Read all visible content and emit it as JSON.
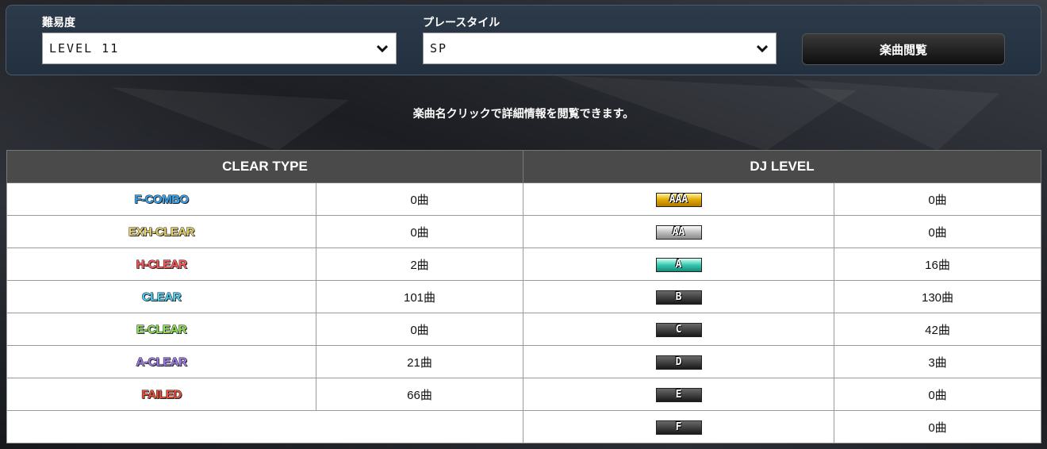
{
  "filter": {
    "difficulty_label": "難易度",
    "difficulty_value": "LEVEL 11",
    "playstyle_label": "プレースタイル",
    "playstyle_value": "SP",
    "browse_button": "楽曲閲覧"
  },
  "note": "楽曲名クリックで詳細情報を閲覧できます。",
  "table": {
    "clear_header": "CLEAR TYPE",
    "dj_header": "DJ LEVEL",
    "clear_rows": [
      {
        "type": "F-COMBO",
        "count": "0曲",
        "color": "#3aa6f0"
      },
      {
        "type": "EXH-CLEAR",
        "count": "0曲",
        "color": "#e8d36a"
      },
      {
        "type": "H-CLEAR",
        "count": "2曲",
        "color": "#ff5a5a"
      },
      {
        "type": "CLEAR",
        "count": "101曲",
        "color": "#4fd0f5"
      },
      {
        "type": "E-CLEAR",
        "count": "0曲",
        "color": "#8fe35a"
      },
      {
        "type": "A-CLEAR",
        "count": "21曲",
        "color": "#9d7be8"
      },
      {
        "type": "FAILED",
        "count": "66曲",
        "color": "#f0503a"
      }
    ],
    "dj_rows": [
      {
        "level": "AAA",
        "count": "0曲",
        "bg": "linear-gradient(#fff4a0,#e0a800,#b07a00)"
      },
      {
        "level": "AA",
        "count": "0曲",
        "bg": "linear-gradient(#ffffff,#bdbdbd,#8a8a8a)"
      },
      {
        "level": "A",
        "count": "16曲",
        "bg": "linear-gradient(#d9fff4,#35c9b0,#168a7a)"
      },
      {
        "level": "B",
        "count": "130曲",
        "bg": "linear-gradient(#6a6a6a,#1a1a1a)"
      },
      {
        "level": "C",
        "count": "42曲",
        "bg": "linear-gradient(#6a6a6a,#1a1a1a)"
      },
      {
        "level": "D",
        "count": "3曲",
        "bg": "linear-gradient(#6a6a6a,#1a1a1a)"
      },
      {
        "level": "E",
        "count": "0曲",
        "bg": "linear-gradient(#6a6a6a,#1a1a1a)"
      },
      {
        "level": "F",
        "count": "0曲",
        "bg": "linear-gradient(#6a6a6a,#1a1a1a)"
      }
    ]
  }
}
